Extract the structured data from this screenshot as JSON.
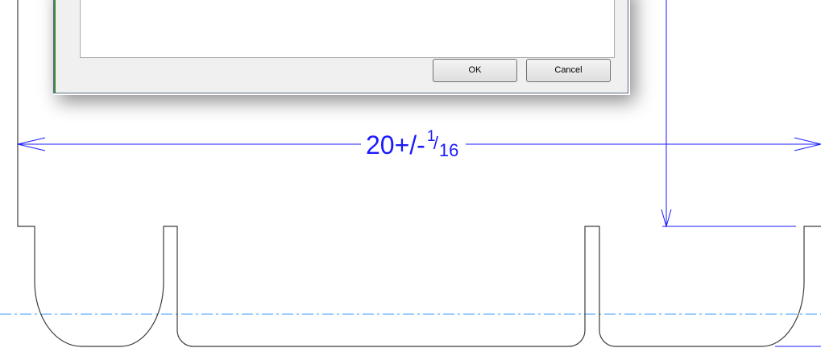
{
  "dialog": {
    "ok_label": "OK",
    "cancel_label": "Cancel"
  },
  "dimension": {
    "base": "20+/-",
    "fraction_numerator": "1",
    "fraction_denominator": "16"
  },
  "colors": {
    "dimension": "#1a1aff",
    "centerline": "#3399ff",
    "geometry": "#3c3c3c"
  }
}
